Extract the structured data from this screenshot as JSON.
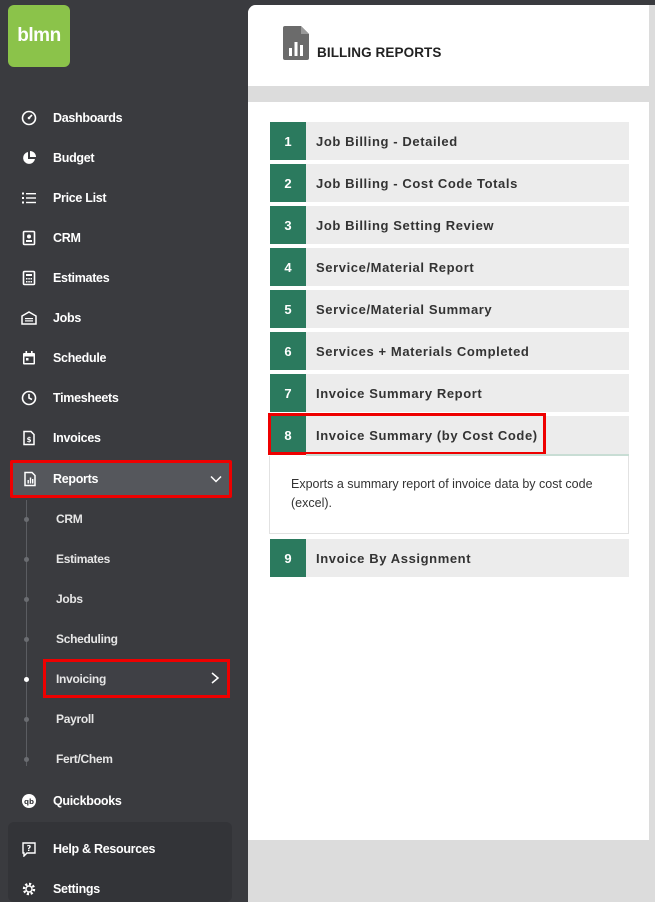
{
  "logo": "blmn",
  "nav": [
    {
      "label": "Dashboards",
      "icon": "gauge-icon"
    },
    {
      "label": "Budget",
      "icon": "pie-chart-icon"
    },
    {
      "label": "Price List",
      "icon": "list-icon"
    },
    {
      "label": "CRM",
      "icon": "contact-card-icon"
    },
    {
      "label": "Estimates",
      "icon": "calculator-icon"
    },
    {
      "label": "Jobs",
      "icon": "garage-icon"
    },
    {
      "label": "Schedule",
      "icon": "calendar-icon"
    },
    {
      "label": "Timesheets",
      "icon": "clock-icon"
    },
    {
      "label": "Invoices",
      "icon": "invoice-icon"
    }
  ],
  "reports": {
    "label": "Reports",
    "icon": "report-icon"
  },
  "submenu": [
    {
      "label": "CRM"
    },
    {
      "label": "Estimates"
    },
    {
      "label": "Jobs"
    },
    {
      "label": "Scheduling"
    },
    {
      "label": "Invoicing"
    },
    {
      "label": "Payroll"
    },
    {
      "label": "Fert/Chem"
    }
  ],
  "quickbooks": {
    "label": "Quickbooks",
    "icon": "quickbooks-icon"
  },
  "help": {
    "label": "Help & Resources",
    "icon": "help-icon"
  },
  "settings": {
    "label": "Settings",
    "icon": "gear-icon"
  },
  "page_title": "BILLING REPORTS",
  "reports_list": [
    {
      "num": "1",
      "label": "Job Billing - Detailed"
    },
    {
      "num": "2",
      "label": "Job Billing - Cost Code Totals"
    },
    {
      "num": "3",
      "label": "Job Billing Setting Review"
    },
    {
      "num": "4",
      "label": "Service/Material Report"
    },
    {
      "num": "5",
      "label": "Service/Material Summary"
    },
    {
      "num": "6",
      "label": "Services + Materials Completed"
    },
    {
      "num": "7",
      "label": "Invoice Summary Report"
    },
    {
      "num": "8",
      "label": "Invoice Summary (by Cost Code)"
    },
    {
      "num": "9",
      "label": "Invoice By Assignment"
    }
  ],
  "expanded_description": "Exports a summary report of invoice data by cost code (excel).",
  "colors": {
    "accent": "#2b7a5e",
    "logo": "#8bc34a",
    "sidebar": "#3a3b3f",
    "highlight": "#e00000"
  }
}
